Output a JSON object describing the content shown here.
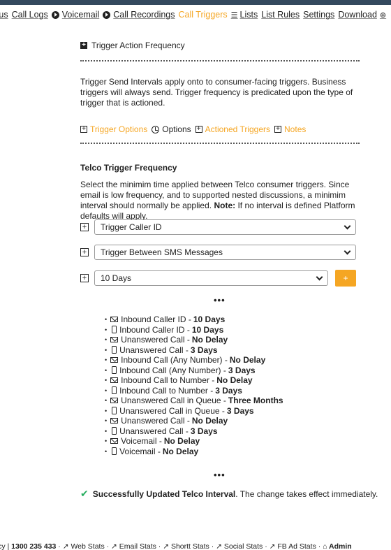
{
  "colors": {
    "accent": "#f5a623",
    "topbar": "#34495e",
    "success": "#27ae60"
  },
  "nav": {
    "items": [
      {
        "label": "atus",
        "active": false
      },
      {
        "label": "Call Logs",
        "active": false
      },
      {
        "label": "Voicemail",
        "active": false,
        "icon": "play-circle-icon"
      },
      {
        "label": "Call Recordings",
        "active": false,
        "icon": "play-circle-icon"
      },
      {
        "label": "Call Triggers",
        "active": true
      },
      {
        "label": "Lists",
        "active": false,
        "icon": "list-icon"
      },
      {
        "label": "List Rules",
        "active": false
      },
      {
        "label": "Settings",
        "active": false
      },
      {
        "label": "Download",
        "active": false,
        "icon": "download-icon"
      }
    ]
  },
  "section": {
    "title": "Trigger Action Frequency",
    "intro": "Trigger Send Intervals apply onto to consumer-facing triggers. Business triggers will always send. Trigger frequency is predicated upon the type of trigger that is actioned."
  },
  "links": {
    "trigger_options": "Trigger Options",
    "options": "Options",
    "actioned_triggers": "Actioned Triggers",
    "notes": "Notes"
  },
  "telco": {
    "heading": "Telco Trigger Frequency",
    "desc_part1": "Select the minimim time applied between Telco consumer triggers. Since email is low frequency, and to supported nested discussions, a minimim interval should normally be applied. ",
    "note_label": "Note:",
    "desc_part2": " If no interval is defined Platform defaults will apply.",
    "select1": "Trigger Caller ID",
    "select2": "Trigger Between SMS Messages",
    "select3": "10 Days",
    "add_button": "+"
  },
  "ellipsis": "•••",
  "intervals": [
    {
      "icon": "email-icon",
      "label": "Inbound Caller ID -",
      "value": "10 Days"
    },
    {
      "icon": "mobile-icon",
      "label": "Inbound Caller ID -",
      "value": "10 Days"
    },
    {
      "icon": "email-icon",
      "label": "Unanswered Call -",
      "value": "No Delay"
    },
    {
      "icon": "mobile-icon",
      "label": "Unanswered Call -",
      "value": "3 Days"
    },
    {
      "icon": "email-icon",
      "label": "Inbound Call (Any Number) -",
      "value": "No Delay"
    },
    {
      "icon": "mobile-icon",
      "label": "Inbound Call (Any Number) -",
      "value": "3 Days"
    },
    {
      "icon": "email-icon",
      "label": "Inbound Call to Number -",
      "value": "No Delay"
    },
    {
      "icon": "mobile-icon",
      "label": "Inbound Call to Number -",
      "value": "3 Days"
    },
    {
      "icon": "email-icon",
      "label": "Unanswered Call in Queue -",
      "value": "Three Months"
    },
    {
      "icon": "mobile-icon",
      "label": "Unanswered Call in Queue -",
      "value": "3 Days"
    },
    {
      "icon": "email-icon",
      "label": "Unanswered Call -",
      "value": "No Delay"
    },
    {
      "icon": "mobile-icon",
      "label": "Unanswered Call -",
      "value": "3 Days"
    },
    {
      "icon": "email-icon",
      "label": "Voicemail -",
      "value": "No Delay"
    },
    {
      "icon": "mobile-icon",
      "label": "Voicemail -",
      "value": "No Delay"
    }
  ],
  "success": {
    "bold": "Successfully Updated Telco Interval",
    "rest": ". The change takes effect immediately."
  },
  "footer": {
    "privacy": "vacy |",
    "phone": "1300 235 433",
    "web_stats": "Web Stats",
    "email_stats": "Email Stats",
    "shortt_stats": "Shortt Stats",
    "social_stats": "Social Stats",
    "fb_stats": "FB Ad Stats",
    "admin": "Admin"
  }
}
